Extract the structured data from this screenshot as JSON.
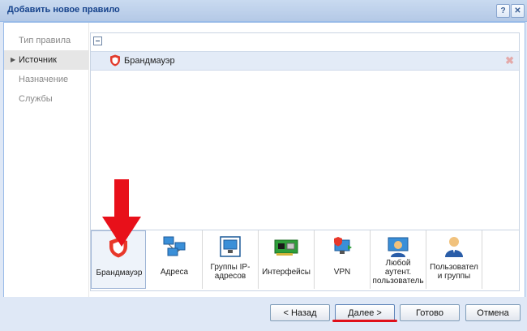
{
  "window": {
    "title": "Добавить новое правило",
    "help_label": "?",
    "close_label": "✕"
  },
  "nav": {
    "items": [
      {
        "label": "Тип правила",
        "active": false
      },
      {
        "label": "Источник",
        "active": true
      },
      {
        "label": "Назначение",
        "active": false
      },
      {
        "label": "Службы",
        "active": false
      }
    ]
  },
  "list": {
    "rows": [
      {
        "label": "Брандмауэр",
        "icon": "firewall-shield-icon"
      }
    ]
  },
  "tiles": [
    {
      "label": [
        "Брандмауэр"
      ],
      "icon": "firewall-shield-icon"
    },
    {
      "label": [
        "Адреса"
      ],
      "icon": "network-addresses-icon"
    },
    {
      "label": [
        "Группы IP-",
        "адресов"
      ],
      "icon": "ip-groups-icon"
    },
    {
      "label": [
        "Интерфейсы"
      ],
      "icon": "network-card-icon"
    },
    {
      "label": [
        "VPN"
      ],
      "icon": "vpn-icon"
    },
    {
      "label": [
        "Любой",
        "аутент.",
        "пользователь"
      ],
      "icon": "authenticated-user-icon"
    },
    {
      "label": [
        "Пользовател",
        "и группы"
      ],
      "icon": "users-groups-icon"
    }
  ],
  "footer": {
    "back_label": "< Назад",
    "next_label": "Далее >",
    "done_label": "Готово",
    "cancel_label": "Отмена"
  },
  "colors": {
    "accent": "#e0101a",
    "title": "#15428b"
  }
}
